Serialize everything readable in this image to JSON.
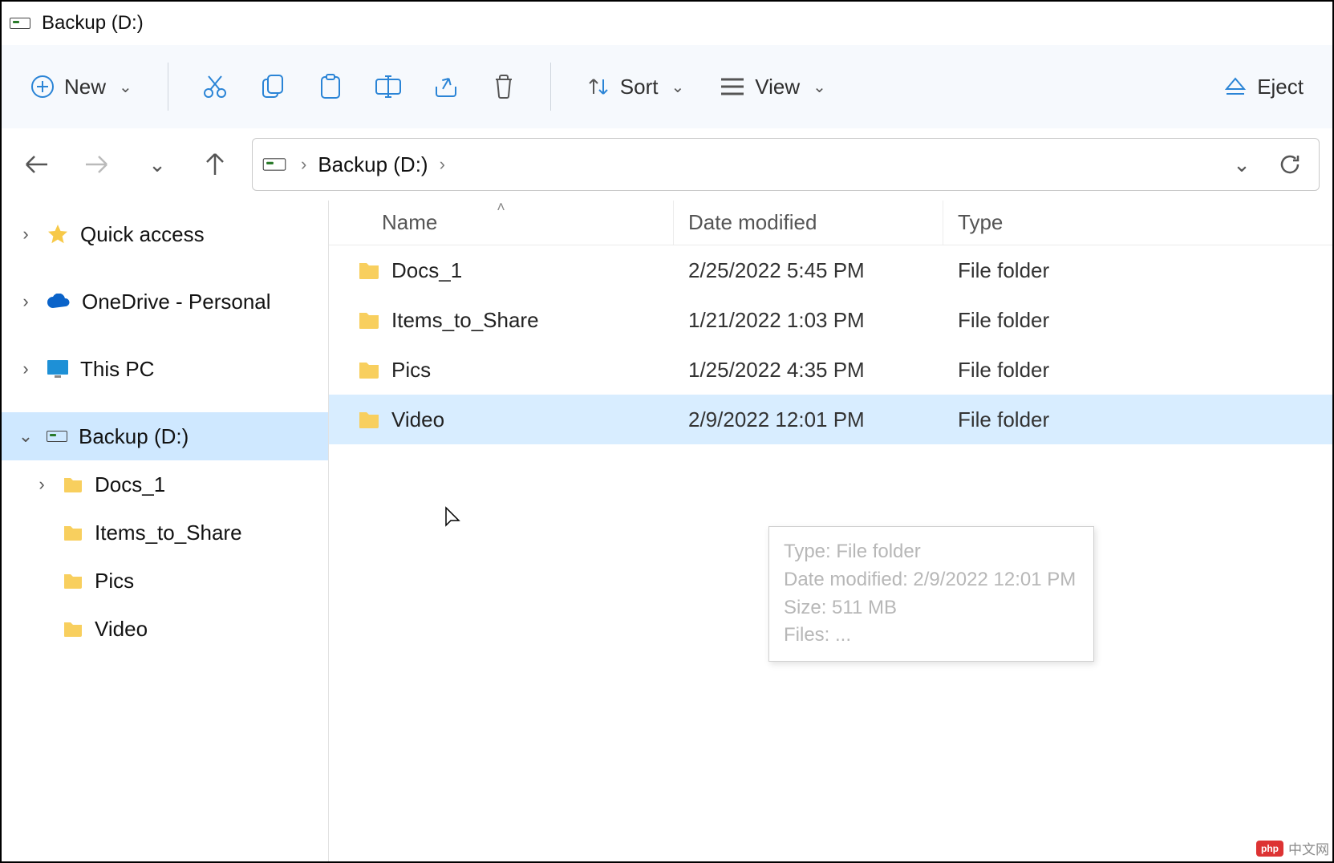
{
  "window_title": "Backup (D:)",
  "toolbar": {
    "new_label": "New",
    "sort_label": "Sort",
    "view_label": "View",
    "eject_label": "Eject"
  },
  "breadcrumb": {
    "current": "Backup (D:)"
  },
  "sidebar": {
    "quick_access": "Quick access",
    "onedrive": "OneDrive - Personal",
    "this_pc": "This PC",
    "backup_drive": "Backup (D:)",
    "children": {
      "0": "Docs_1",
      "1": "Items_to_Share",
      "2": "Pics",
      "3": "Video"
    }
  },
  "columns": {
    "name": "Name",
    "date": "Date modified",
    "type": "Type"
  },
  "files": {
    "0": {
      "name": "Docs_1",
      "date": "2/25/2022 5:45 PM",
      "type": "File folder"
    },
    "1": {
      "name": "Items_to_Share",
      "date": "1/21/2022 1:03 PM",
      "type": "File folder"
    },
    "2": {
      "name": "Pics",
      "date": "1/25/2022 4:35 PM",
      "type": "File folder"
    },
    "3": {
      "name": "Video",
      "date": "2/9/2022 12:01 PM",
      "type": "File folder"
    }
  },
  "tooltip": {
    "l0": "Type: File folder",
    "l1": "Date modified: 2/9/2022 12:01 PM",
    "l2": "Size: 511 MB",
    "l3": "Files: ..."
  },
  "watermark": {
    "badge": "php",
    "text": "中文网"
  }
}
